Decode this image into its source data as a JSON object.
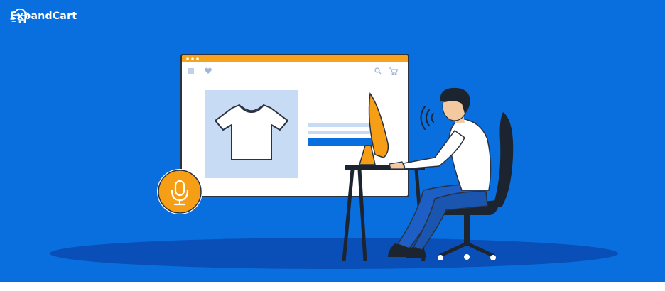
{
  "brand": {
    "name": "ExpandCart",
    "icon": "cart-cloud-icon"
  },
  "colors": {
    "background": "#0a6fde",
    "floor": "#0a4fb8",
    "window_bar": "#f6a21c",
    "window_body": "#ffffff",
    "product_panel": "#c7dbf5",
    "mic_badge": "#f59e16",
    "monitor": "#f59e16",
    "shirt": "#ffffff",
    "pants": "#1d5fc4",
    "chair": "#1c2430"
  },
  "illustration": {
    "browser_icons": [
      "menu-icon",
      "heart-icon",
      "search-icon",
      "cart-icon"
    ],
    "voice_icons": [
      "microphone-icon",
      "sound-waves-icon"
    ]
  }
}
